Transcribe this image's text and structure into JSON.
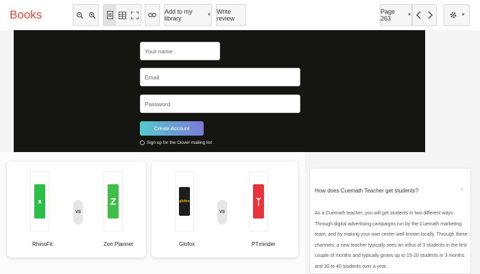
{
  "toolbar": {
    "brand": "Books",
    "zoom_out_icon": "zoom-out-icon",
    "zoom_in_icon": "zoom-in-icon",
    "add_library_label": "Add to my library",
    "write_review_label": "Write review",
    "page_label": "Page 263"
  },
  "signup": {
    "name_placeholder": "Your name",
    "email_placeholder": "Email",
    "password_placeholder": "Password",
    "cta_label": "Create Account",
    "optin_label": "Sign up for the Clover mailing list"
  },
  "comparisons": [
    {
      "left": {
        "name": "RhinoFit",
        "color": "#2bbf4a"
      },
      "vs": "VS",
      "right": {
        "name": "Zen Planner",
        "color": "#3fbf47"
      }
    },
    {
      "left": {
        "name": "Glofox",
        "color": "#1d1d1d"
      },
      "vs": "VS",
      "right": {
        "name": "PTminder",
        "color": "#e8333b"
      }
    }
  ],
  "faq": {
    "question": "How does Cuemath Teacher get students?",
    "answer": "As a Cuemath teacher, you will get students in two different ways. Through digital advertising campaigns run by the Cuemath marketing team, and by making your own center well known locally. Through these channels, a new teacher typically sees an influx of 3 students in the first couple of months and typically grows up to 15-20 students in 3 months and 30 to 40 students over a year."
  },
  "colors": {
    "brand": "#dd4b39",
    "cta_start": "#54c9cf",
    "cta_end": "#7b7bd8"
  }
}
